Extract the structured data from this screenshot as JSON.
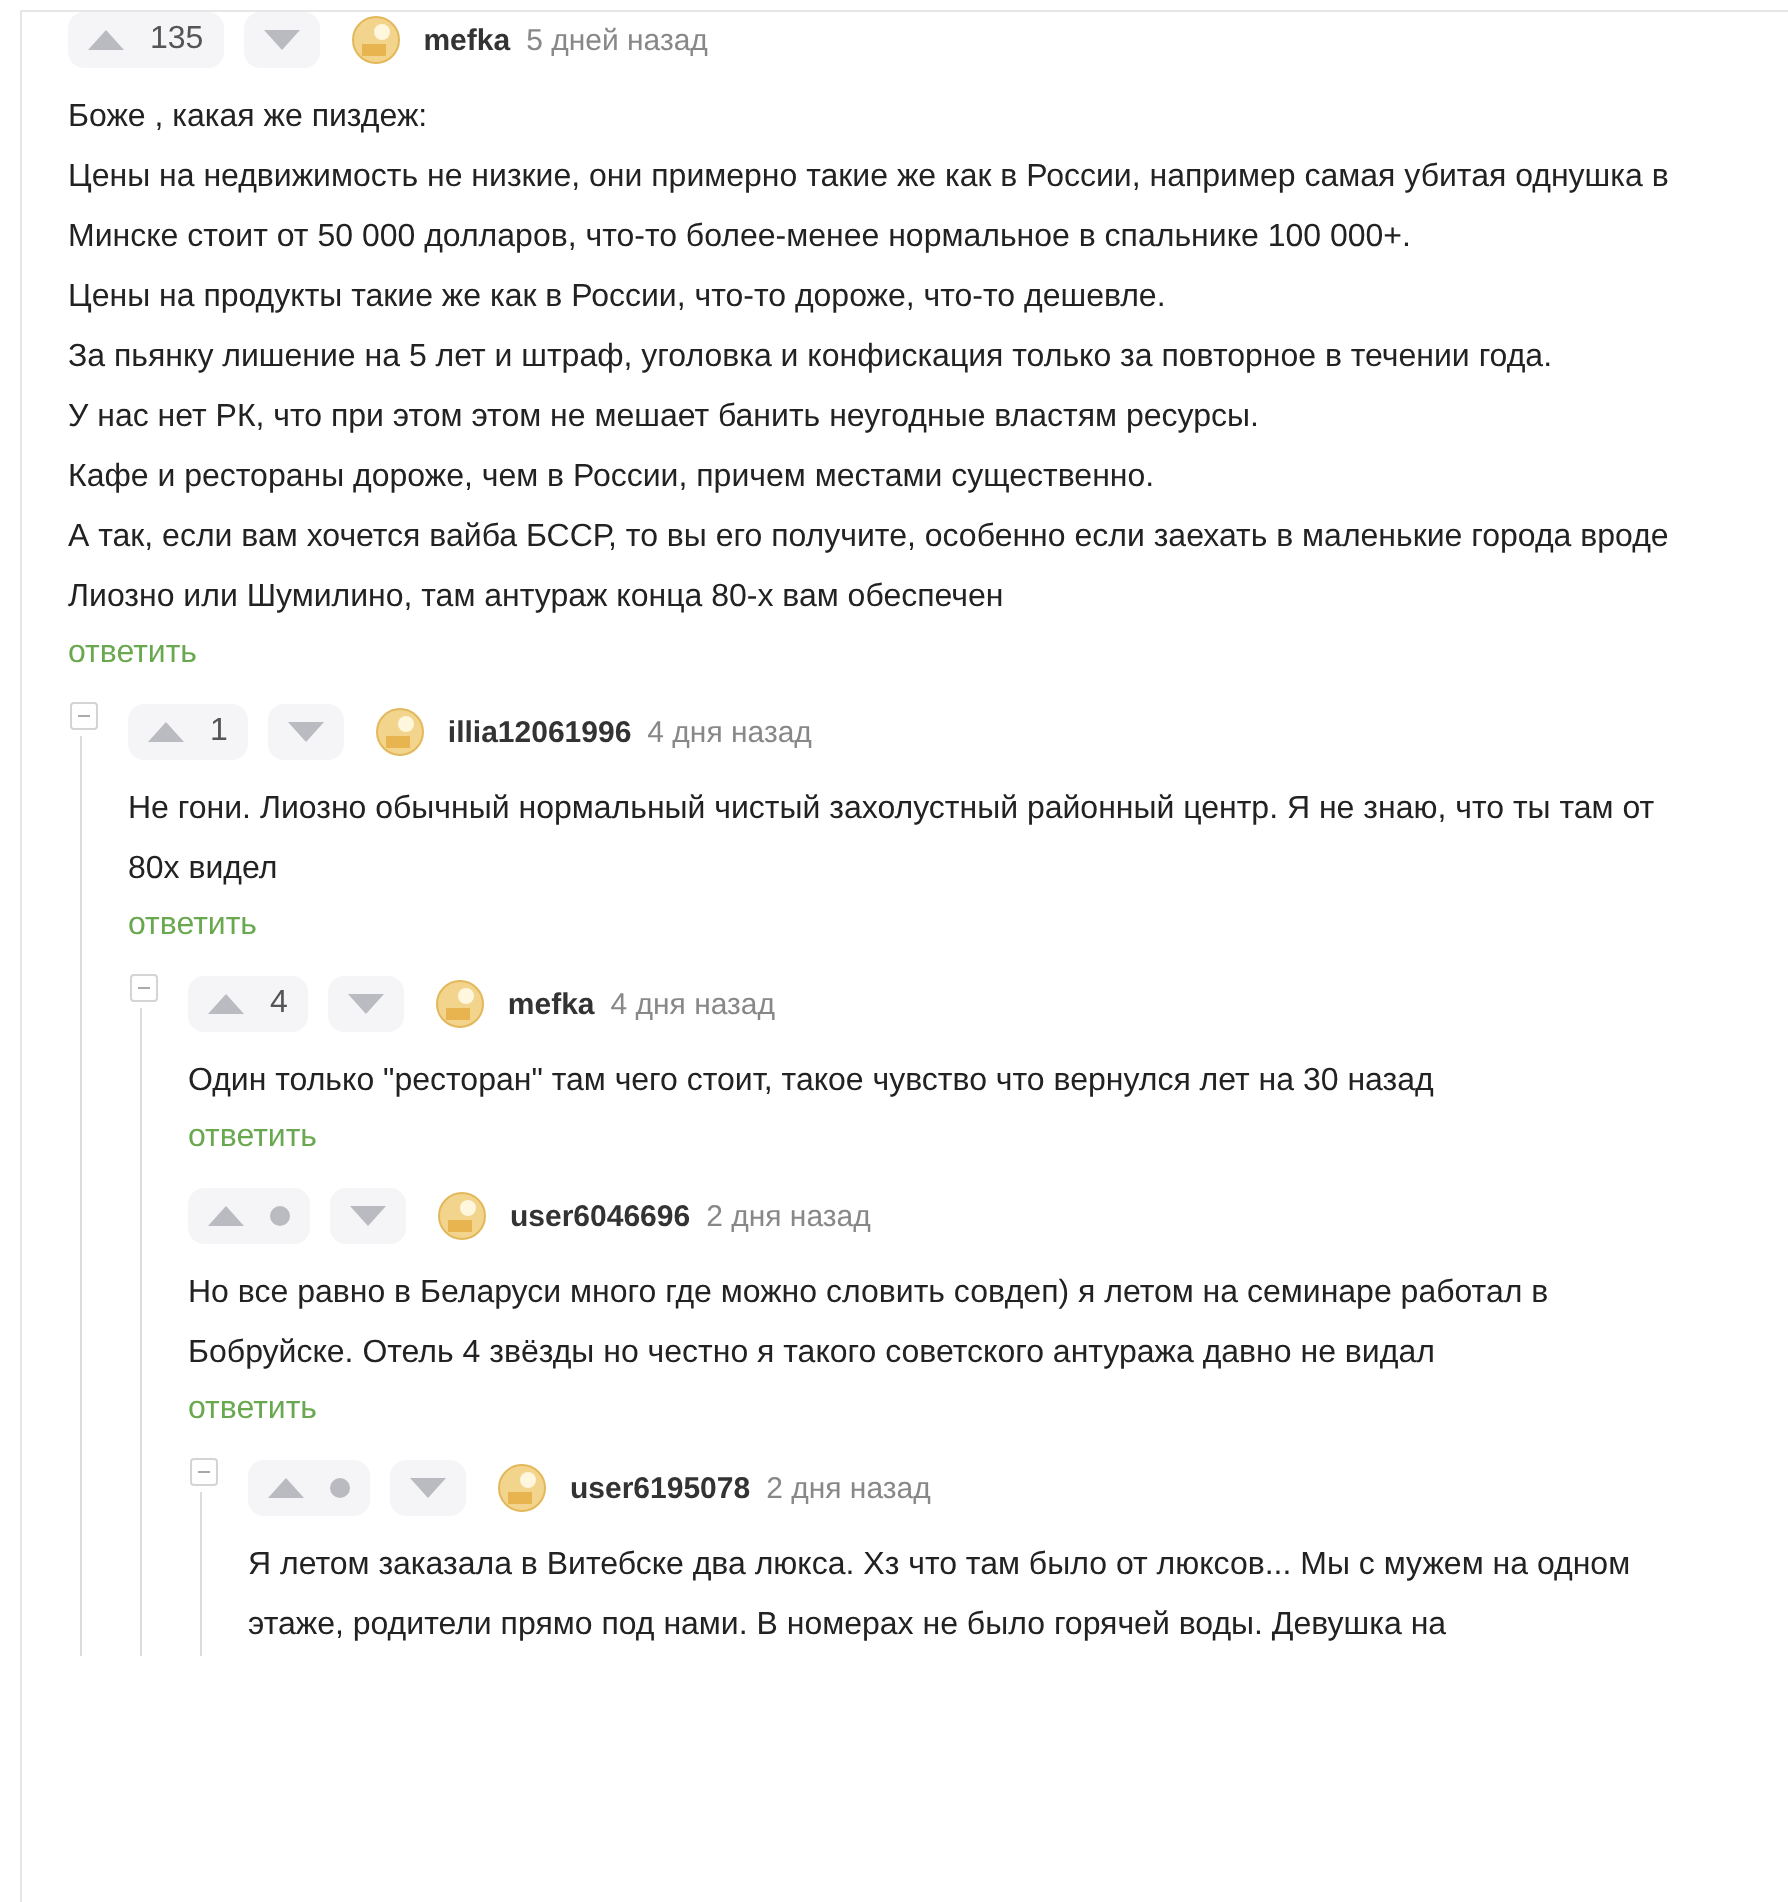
{
  "comments": [
    {
      "score": "135",
      "author": "mefka",
      "time": "5 дней назад",
      "collapse_button": false,
      "paragraphs": [
        "Боже , какая же пиздеж:",
        "Цены на недвижимость не низкие, они примерно такие же как в России, например самая убитая однушка в Минске стоит от 50 000 долларов, что-то более-менее нормальное в спальнике 100 000+.",
        "Цены на продукты такие же как в России, что-то дороже, что-то дешевле.",
        "За пьянку лишение на 5 лет и штраф, уголовка и конфискация только за повторное в течении года.",
        "У нас нет РК, что при этом этом не мешает банить неугодные властям ресурсы.",
        "Кафе и рестораны дороже, чем в России, причем местами существенно.",
        "А так, если вам хочется вайба БССР, то вы его получите, особенно если заехать в маленькие города вроде Лиозно или Шумилино, там антураж конца 80-х вам обеспечен"
      ],
      "reply": "ответить",
      "children": [
        {
          "score": "1",
          "author": "illia12061996",
          "time": "4 дня назад",
          "collapse_button": true,
          "paragraphs": [
            "Не гони. Лиозно обычный нормальный чистый захолустный районный центр. Я не знаю, что ты там от 80х видел"
          ],
          "reply": "ответить",
          "children": [
            {
              "score": "4",
              "author": "mefka",
              "time": "4 дня назад",
              "collapse_button": true,
              "paragraphs": [
                "Один только \"ресторан\" там чего стоит, такое чувство что вернулся лет на 30 назад"
              ],
              "reply": "ответить",
              "children": [
                {
                  "author": "user6046696",
                  "time": "2 дня назад",
                  "collapse_button": false,
                  "paragraphs": [
                    "Но все равно в Беларуси много где можно словить совдеп) я летом на семинаре работал в Бобруйске. Отель 4 звёзды но честно я такого советского антуража давно не видал"
                  ],
                  "reply": "ответить",
                  "children": [
                    {
                      "author": "user6195078",
                      "time": "2 дня назад",
                      "collapse_button": true,
                      "paragraphs": [
                        "Я летом заказала в Витебске два люкса. Хз что там было от люксов... Мы с мужем на одном этаже, родители прямо под нами. В номерах не было горячей воды. Девушка на"
                      ]
                    }
                  ]
                }
              ]
            }
          ]
        }
      ]
    }
  ]
}
